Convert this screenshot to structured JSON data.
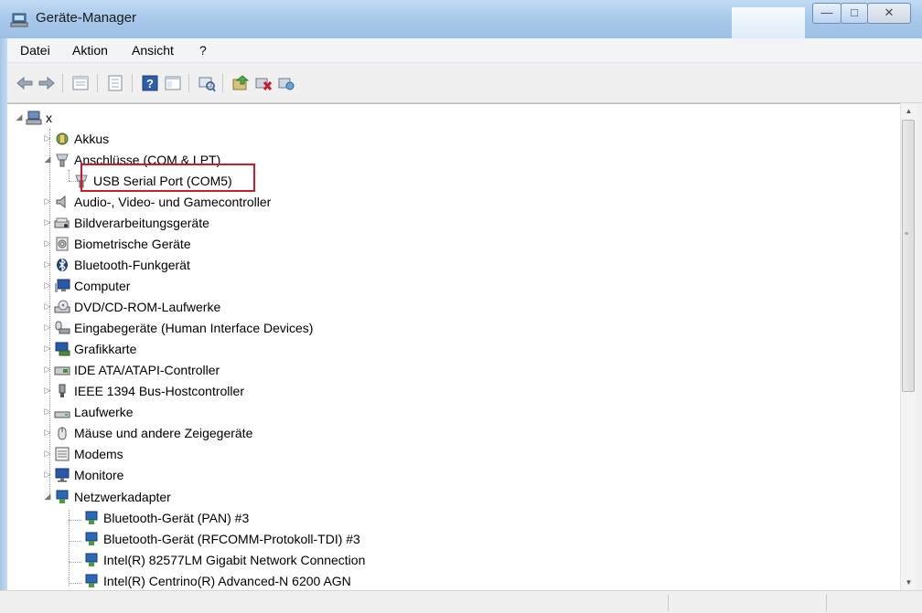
{
  "window": {
    "title": "Geräte-Manager",
    "accent": "#a9c9ea"
  },
  "menubar": {
    "items": [
      "Datei",
      "Aktion",
      "Ansicht",
      "?"
    ]
  },
  "toolbar": {
    "buttons": [
      "back-icon",
      "forward-icon",
      "properties-icon",
      "view-icon",
      "help-icon",
      "console-tree-icon",
      "scan-hardware-icon",
      "update-driver-icon",
      "disable-device-icon",
      "uninstall-icon"
    ]
  },
  "tree": {
    "root": "x",
    "items": [
      {
        "label": "Akkus",
        "expanded": false
      },
      {
        "label": "Anschlüsse (COM & LPT)",
        "expanded": true,
        "children": [
          {
            "label": "USB Serial Port (COM5)",
            "highlighted": true
          }
        ]
      },
      {
        "label": "Audio-, Video- und Gamecontroller",
        "expanded": false
      },
      {
        "label": "Bildverarbeitungsgeräte",
        "expanded": false
      },
      {
        "label": "Biometrische Geräte",
        "expanded": false
      },
      {
        "label": "Bluetooth-Funkgerät",
        "expanded": false
      },
      {
        "label": "Computer",
        "expanded": false
      },
      {
        "label": "DVD/CD-ROM-Laufwerke",
        "expanded": false
      },
      {
        "label": "Eingabegeräte (Human Interface Devices)",
        "expanded": false
      },
      {
        "label": "Grafikkarte",
        "expanded": false
      },
      {
        "label": "IDE ATA/ATAPI-Controller",
        "expanded": false
      },
      {
        "label": "IEEE 1394 Bus-Hostcontroller",
        "expanded": false
      },
      {
        "label": "Laufwerke",
        "expanded": false
      },
      {
        "label": "Mäuse und andere Zeigegeräte",
        "expanded": false
      },
      {
        "label": "Modems",
        "expanded": false
      },
      {
        "label": "Monitore",
        "expanded": false
      },
      {
        "label": "Netzwerkadapter",
        "expanded": true,
        "children": [
          {
            "label": "Bluetooth-Gerät (PAN) #3"
          },
          {
            "label": "Bluetooth-Gerät (RFCOMM-Protokoll-TDI) #3"
          },
          {
            "label": "Intel(R) 82577LM Gigabit Network Connection"
          },
          {
            "label": "Intel(R) Centrino(R) Advanced-N 6200 AGN"
          }
        ]
      }
    ]
  },
  "colors": {
    "highlight_border": "#d0192b"
  }
}
